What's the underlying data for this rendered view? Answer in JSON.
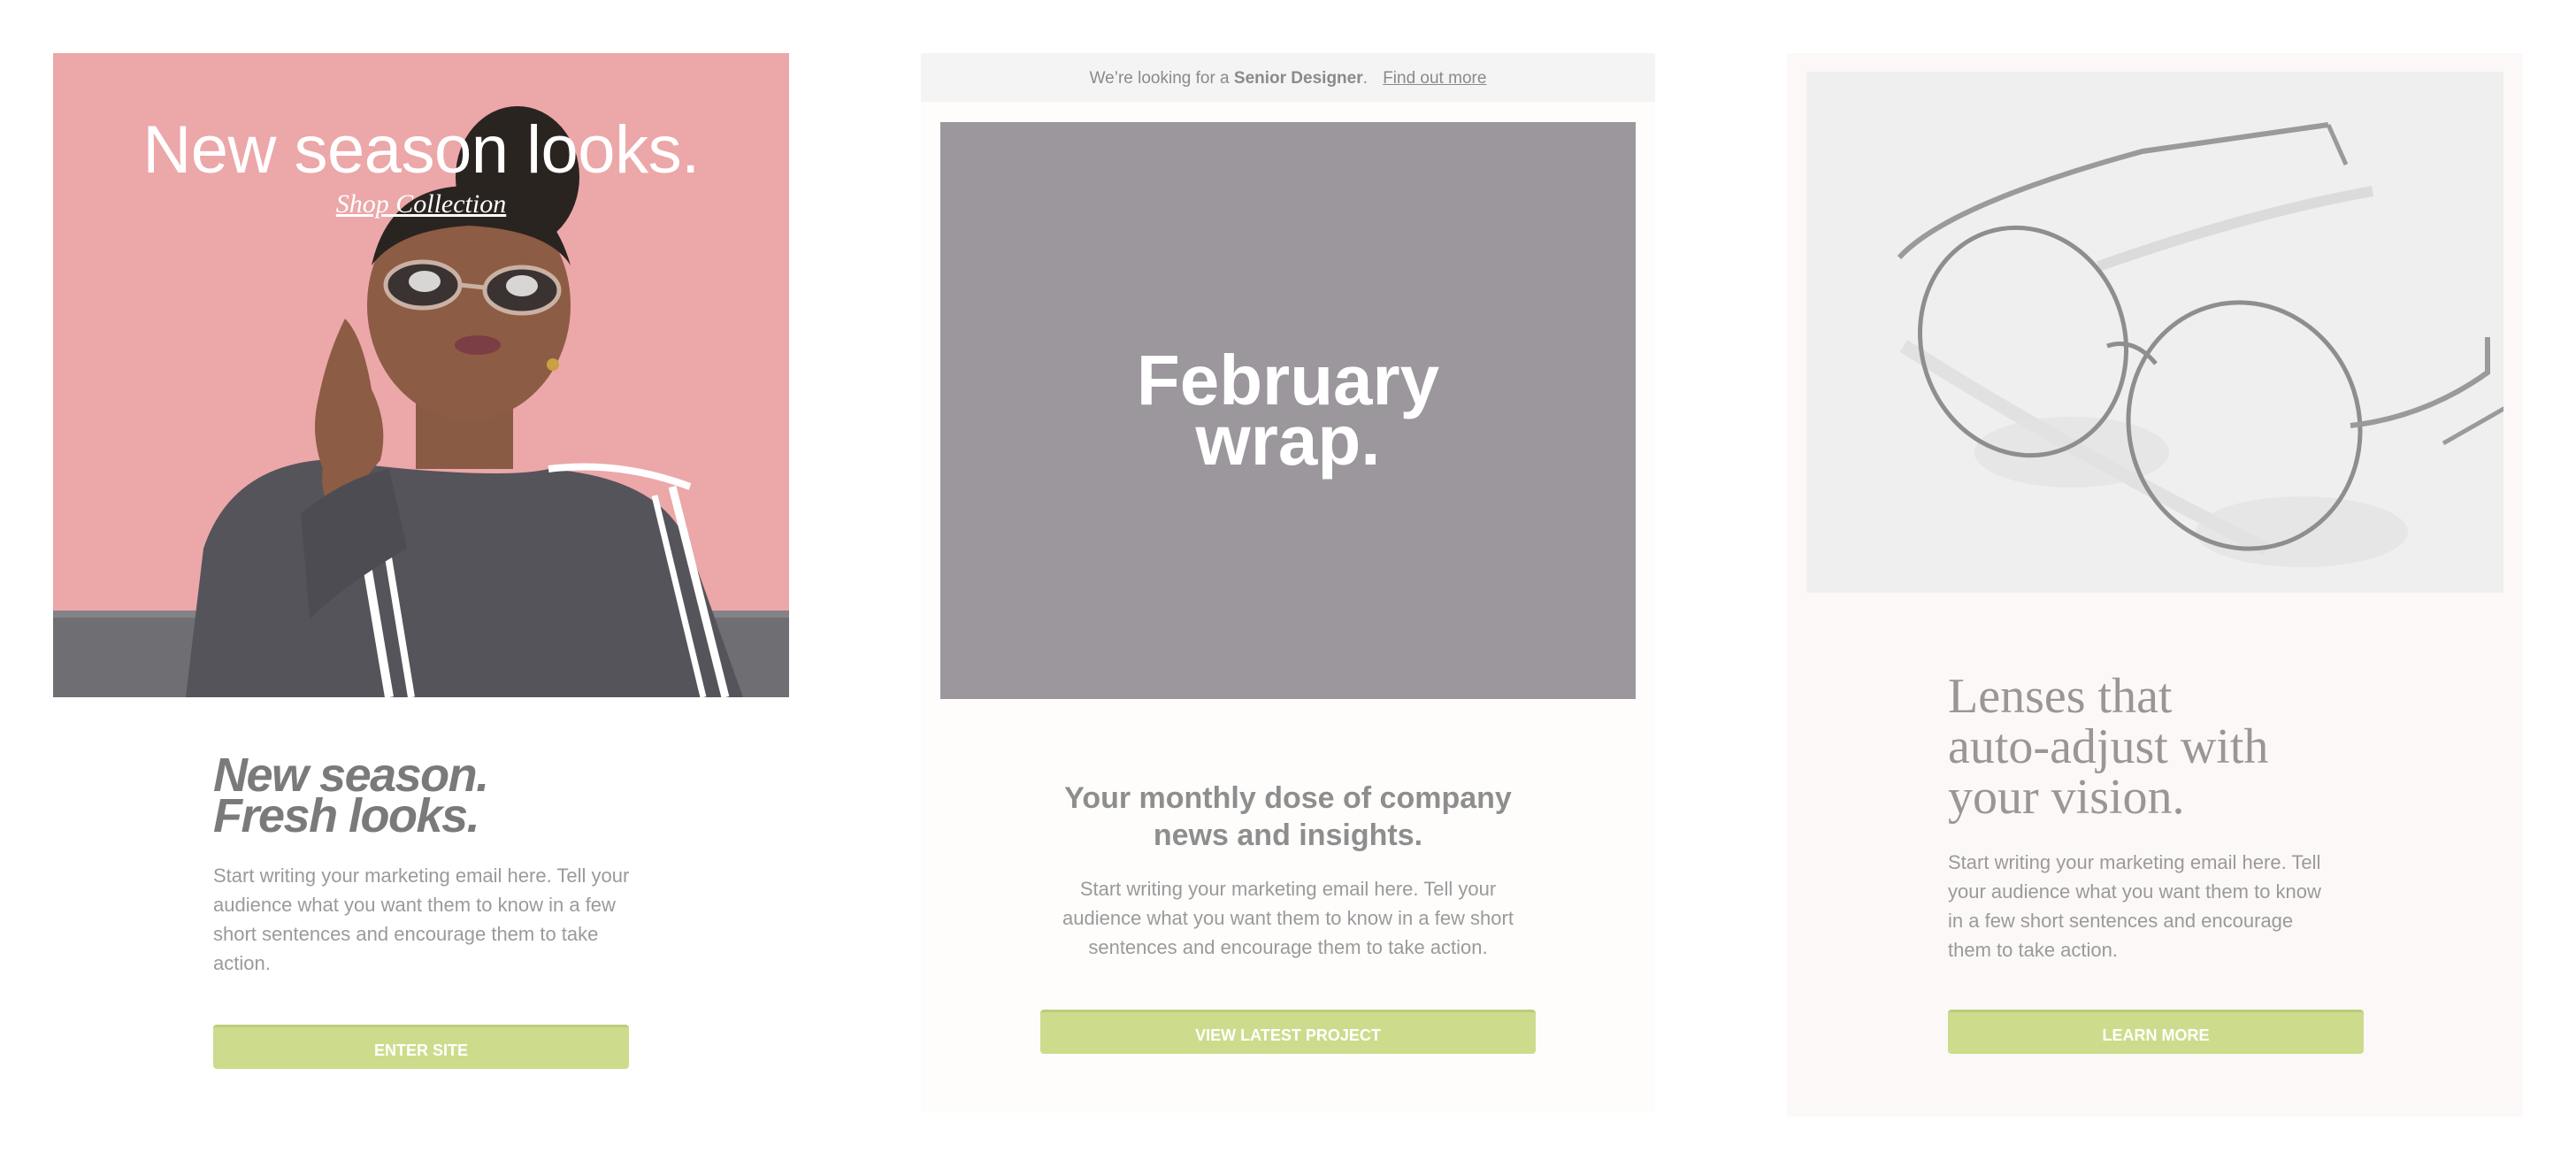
{
  "colors": {
    "page_bg": "#ffffff",
    "card1_hero_bg": "#eca7a9",
    "card2_hero_bg": "#9b979d",
    "card3_bg": "#fcf8f7",
    "cta_bg": "#ccdc8c",
    "cta_text": "#ffffff",
    "heading_gray": "#7a7a7a",
    "body_gray": "#9a9a9a"
  },
  "card1": {
    "hero_title": "New season looks.",
    "hero_link": "Shop Collection",
    "headline_line1": "New season.",
    "headline_line2": "Fresh looks.",
    "body": "Start writing your marketing email here. Tell your audience what you want them to know in a few short sentences and encourage them to take action.",
    "cta": "ENTER SITE",
    "image": "woman-in-sunglasses-photo"
  },
  "card2": {
    "banner_prefix": "We’re looking for a ",
    "banner_role": "Senior Designer",
    "banner_suffix": ".",
    "banner_link": "Find out more",
    "hero_line1": "February",
    "hero_line2": "wrap.",
    "headline": "Your monthly dose of company news and insights.",
    "body": "Start writing your marketing email here. Tell your audience what you want them to know in a few short sentences and encourage them to take action.",
    "cta": "VIEW LATEST PROJECT"
  },
  "card3": {
    "image": "eyeglasses-photo",
    "headline_line1": "Lenses that",
    "headline_line2": "auto-adjust with",
    "headline_line3": "your vision.",
    "body": "Start writing your marketing email here. Tell your audience what you want them to know in a few short sentences and encourage them to take action.",
    "cta": "LEARN MORE"
  }
}
